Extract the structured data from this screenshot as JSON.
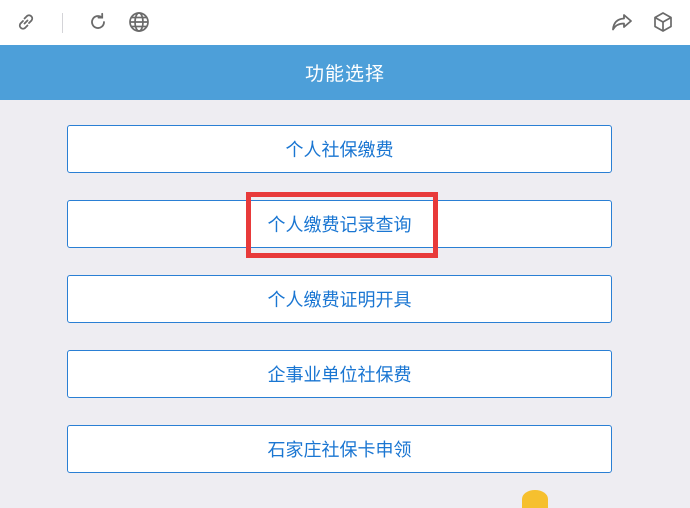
{
  "toolbar": {
    "icons": [
      "link-icon",
      "refresh-icon",
      "globe-icon",
      "share-icon",
      "cube-icon"
    ]
  },
  "header": {
    "title": "功能选择"
  },
  "menu": {
    "items": [
      {
        "label": "个人社保缴费"
      },
      {
        "label": "个人缴费记录查询"
      },
      {
        "label": "个人缴费证明开具"
      },
      {
        "label": "企事业单位社保费"
      },
      {
        "label": "石家庄社保卡申领"
      }
    ]
  },
  "colors": {
    "header_bg": "#4d9fd9",
    "button_text": "#1a76d2",
    "button_border": "#2a7fd4",
    "highlight": "#e83a3a",
    "page_bg": "#eeedf2"
  }
}
